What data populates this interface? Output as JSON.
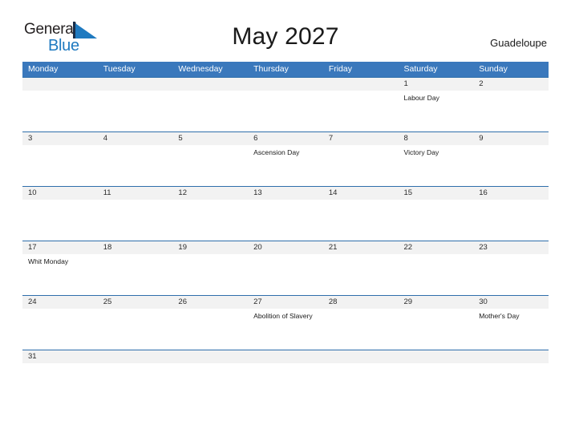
{
  "brand": {
    "word1": "General",
    "word2": "Blue",
    "triangle_icon": "triangle-icon",
    "color_primary": "#1f7ac0",
    "color_text": "#231f20"
  },
  "header": {
    "title": "May 2027",
    "location": "Guadeloupe"
  },
  "theme": {
    "header_blue": "#3a78bc",
    "row_border_blue": "#2f6fab",
    "date_band_gray": "#f2f2f2",
    "page_background": "#ffffff"
  },
  "calendar": {
    "month": "May",
    "year": "2027",
    "weekday_headers": [
      "Monday",
      "Tuesday",
      "Wednesday",
      "Thursday",
      "Friday",
      "Saturday",
      "Sunday"
    ],
    "weeks": [
      {
        "days": [
          {
            "num": "",
            "event": ""
          },
          {
            "num": "",
            "event": ""
          },
          {
            "num": "",
            "event": ""
          },
          {
            "num": "",
            "event": ""
          },
          {
            "num": "",
            "event": ""
          },
          {
            "num": "1",
            "event": "Labour Day"
          },
          {
            "num": "2",
            "event": ""
          }
        ]
      },
      {
        "days": [
          {
            "num": "3",
            "event": ""
          },
          {
            "num": "4",
            "event": ""
          },
          {
            "num": "5",
            "event": ""
          },
          {
            "num": "6",
            "event": "Ascension Day"
          },
          {
            "num": "7",
            "event": ""
          },
          {
            "num": "8",
            "event": "Victory Day"
          },
          {
            "num": "9",
            "event": ""
          }
        ]
      },
      {
        "days": [
          {
            "num": "10",
            "event": ""
          },
          {
            "num": "11",
            "event": ""
          },
          {
            "num": "12",
            "event": ""
          },
          {
            "num": "13",
            "event": ""
          },
          {
            "num": "14",
            "event": ""
          },
          {
            "num": "15",
            "event": ""
          },
          {
            "num": "16",
            "event": ""
          }
        ]
      },
      {
        "days": [
          {
            "num": "17",
            "event": "Whit Monday"
          },
          {
            "num": "18",
            "event": ""
          },
          {
            "num": "19",
            "event": ""
          },
          {
            "num": "20",
            "event": ""
          },
          {
            "num": "21",
            "event": ""
          },
          {
            "num": "22",
            "event": ""
          },
          {
            "num": "23",
            "event": ""
          }
        ]
      },
      {
        "days": [
          {
            "num": "24",
            "event": ""
          },
          {
            "num": "25",
            "event": ""
          },
          {
            "num": "26",
            "event": ""
          },
          {
            "num": "27",
            "event": "Abolition of Slavery"
          },
          {
            "num": "28",
            "event": ""
          },
          {
            "num": "29",
            "event": ""
          },
          {
            "num": "30",
            "event": "Mother's Day"
          }
        ]
      },
      {
        "days": [
          {
            "num": "31",
            "event": ""
          },
          {
            "num": "",
            "event": ""
          },
          {
            "num": "",
            "event": ""
          },
          {
            "num": "",
            "event": ""
          },
          {
            "num": "",
            "event": ""
          },
          {
            "num": "",
            "event": ""
          },
          {
            "num": "",
            "event": ""
          }
        ]
      }
    ]
  }
}
